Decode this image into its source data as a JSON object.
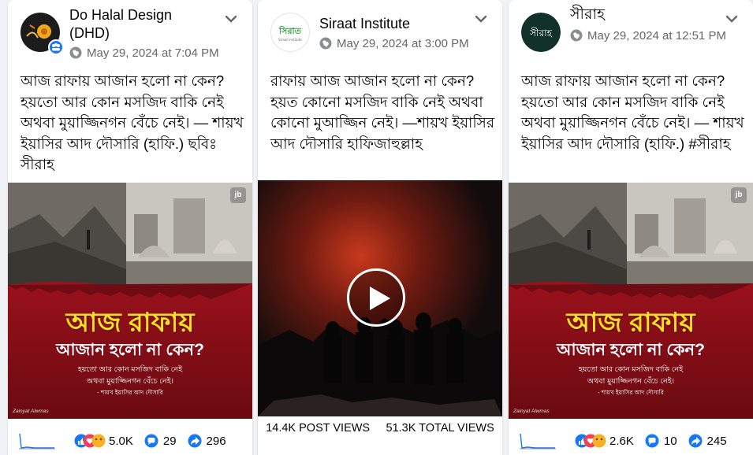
{
  "posts": [
    {
      "author": "Do Halal Design (DHD)",
      "timestamp": "May 29, 2024 at 7:04 PM",
      "text": "আজ রাফায় আজান হলো না কেন? হয়তো আর কোন মসজিদ বাকি নেই অথবা মুয়াজ্জিনগন বেঁচে নেই। — শায়খ ইয়াসির আদ দৌসারি (হাফি.) ছবিঃ সীরাহ",
      "poster": {
        "title": "আজ রাফায়",
        "subtitle": "আজান হলো না কেন?",
        "line1": "হয়তো আর কোন মসজিদ বাকি নেই",
        "line2": "অথবা মুয়াজ্জিনগন বেঁচে নেই।",
        "credit": "- শায়খ ইয়াসির আদ দৌসারি",
        "sign": "Zainyat Alwmas",
        "logo": "jb"
      },
      "stats": {
        "reactions": "5.0K",
        "comments": "29",
        "shares": "296"
      }
    },
    {
      "author": "Siraat Institute",
      "timestamp": "May 29, 2024 at 3:00 PM",
      "text": "রাফায় আজ আজান হলো না কেন? হয়ত কোনো মসজিদ বাকি নেই অথবা কোনো মুআজ্জিন নেই। —শায়খ ইয়াসির আদ দৌসারি হাফিজাহুল্লাহ",
      "avatar_text": "সিরাত",
      "avatar_sub": "Siraat Institute",
      "views": {
        "post_views": "14.4K POST VIEWS",
        "total_views": "51.3K TOTAL VIEWS"
      }
    },
    {
      "author": "সীরাহ",
      "timestamp": "May 29, 2024 at 12:51 PM",
      "text": "আজ রাফায় আজান হলো না কেন? হয়তো আর কোন মসজিদ বাকি নেই অথবা মুয়াজ্জিনগন বেঁচে নেই। — শায়খ ইয়াসির আদ দৌসারি (হাফি.) #সীরাহ",
      "avatar_text": "সীরাহ",
      "poster": {
        "title": "আজ রাফায়",
        "subtitle": "আজান হলো না কেন?",
        "line1": "হয়তো আর কোন মসজিদ বাকি নেই",
        "line2": "অথবা মুয়াজ্জিনগন বেঁচে নেই।",
        "credit": "- শায়খ ইয়াসির আদ দৌসারি",
        "sign": "Zainyat Alwmas",
        "logo": "jb"
      },
      "stats": {
        "reactions": "2.6K",
        "comments": "10",
        "shares": "245"
      }
    }
  ],
  "colors": {
    "link_blue": "#1877f2",
    "poster_red": "#a5121d",
    "poster_yellow": "#f8e026",
    "meta_gray": "#65676b"
  }
}
